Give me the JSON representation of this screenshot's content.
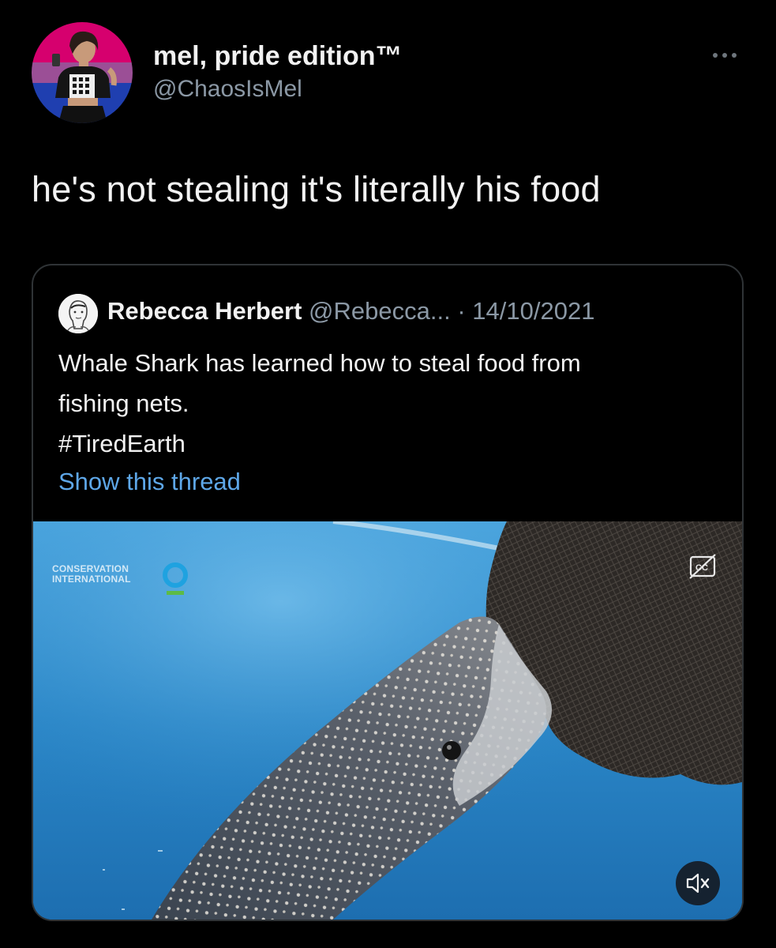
{
  "tweet": {
    "author": {
      "display_name": "mel, pride edition™",
      "handle": "@ChaosIsMel",
      "avatar_icon": "profile-photo-bi-pride-avatar"
    },
    "more_icon": "ellipsis-icon",
    "text": "he's not stealing it's literally his food"
  },
  "quoted_tweet": {
    "author": {
      "display_name": "Rebecca Herbert",
      "handle": "@Rebecca...",
      "avatar_icon": "sketch-portrait-avatar"
    },
    "separator": "·",
    "date": "14/10/2021",
    "body_lines": [
      "Whale Shark has learned how to steal food from",
      "fishing nets.",
      "#TiredEarth"
    ],
    "show_thread": "Show this thread",
    "media": {
      "description_icon": "video-whale-shark-net",
      "watermark_line1": "CONSERVATION",
      "watermark_line2": "INTERNATIONAL",
      "cc_icon": "closed-captions-off-icon",
      "mute_icon": "speaker-muted-icon"
    }
  },
  "colors": {
    "background": "#000000",
    "text_primary": "#f2f2f2",
    "text_secondary": "#8b98a5",
    "link": "#5ea7e8",
    "card_border": "#2f3336"
  }
}
